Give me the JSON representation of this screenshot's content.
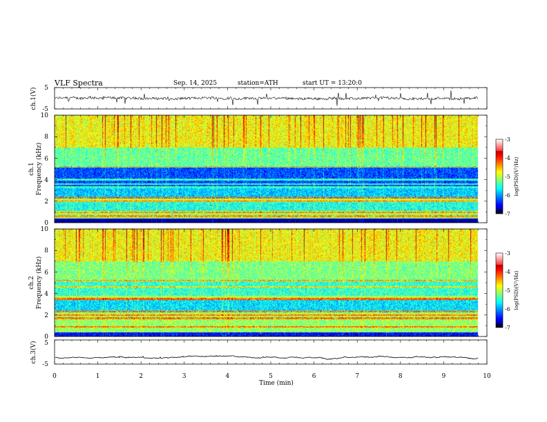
{
  "header": {
    "title": "VLF  Spectra",
    "date": "Sep. 14, 2025",
    "station": "station=ATH",
    "start_ut": "start  UT  =    13:20:0"
  },
  "chart_data": [
    {
      "type": "line",
      "panel": "ch1-waveform",
      "ylabel": "ch.1(V)",
      "ylim": [
        -5,
        5
      ],
      "yticks": [
        "5",
        "-5"
      ],
      "xlim": [
        0,
        10
      ],
      "mean": 0.0,
      "amplitude": 1.2,
      "spike_amplitude": 3.5,
      "end_min": 9.8,
      "color": "#000000"
    },
    {
      "type": "heatmap",
      "panel": "ch1-spectrogram",
      "ylabel_top": "ch.1",
      "ylabel": "Frequency  (kHz)",
      "ylim": [
        0,
        10
      ],
      "yticks": [
        "0",
        "2",
        "4",
        "6",
        "8",
        "10"
      ],
      "xlim": [
        0,
        10
      ],
      "end_min": 9.8,
      "colorbar": {
        "label": "log(PSD)(V²/Hz)",
        "range": [
          -7,
          -3
        ],
        "ticks": [
          "-3",
          "-4",
          "-5",
          "-6",
          "-7"
        ]
      },
      "bands": [
        {
          "f": [
            0.0,
            0.4
          ],
          "psd": -6.9
        },
        {
          "f": [
            0.4,
            1.0
          ],
          "psd": -5.0
        },
        {
          "f": [
            1.0,
            2.0
          ],
          "psd": -5.4
        },
        {
          "f": [
            2.0,
            2.4
          ],
          "psd": -4.8
        },
        {
          "f": [
            2.4,
            3.2
          ],
          "psd": -5.7
        },
        {
          "f": [
            3.2,
            5.2
          ],
          "psd": -6.2
        },
        {
          "f": [
            5.2,
            7.0
          ],
          "psd": -5.1
        },
        {
          "f": [
            7.0,
            10.0
          ],
          "psd": -4.5
        }
      ],
      "lines_khz": [
        0.6,
        1.0,
        2.0,
        2.3,
        3.3,
        3.6,
        4.0,
        5.2
      ]
    },
    {
      "type": "heatmap",
      "panel": "ch2-spectrogram",
      "ylabel_top": "ch.2",
      "ylabel": "Frequency  (kHz)",
      "ylim": [
        0,
        10
      ],
      "yticks": [
        "0",
        "2",
        "4",
        "6",
        "8",
        "10"
      ],
      "xlim": [
        0,
        10
      ],
      "end_min": 9.8,
      "colorbar": {
        "label": "log(PSD)(V²/Hz)",
        "range": [
          -7,
          -3
        ],
        "ticks": [
          "-3",
          "-4",
          "-5",
          "-6",
          "-7"
        ]
      },
      "bands": [
        {
          "f": [
            0.0,
            0.4
          ],
          "psd": -6.5
        },
        {
          "f": [
            0.4,
            2.4
          ],
          "psd": -4.9
        },
        {
          "f": [
            2.4,
            3.4
          ],
          "psd": -5.6
        },
        {
          "f": [
            3.4,
            3.8
          ],
          "psd": -4.8
        },
        {
          "f": [
            3.8,
            5.2
          ],
          "psd": -5.3
        },
        {
          "f": [
            5.2,
            7.0
          ],
          "psd": -5.0
        },
        {
          "f": [
            7.0,
            10.0
          ],
          "psd": -4.5
        }
      ],
      "lines_khz": [
        0.9,
        1.7,
        2.0,
        2.3,
        3.5,
        4.6,
        5.2
      ]
    },
    {
      "type": "line",
      "panel": "ch3-waveform",
      "ylabel": "ch.3(V)",
      "ylim": [
        -5,
        5
      ],
      "yticks": [
        "5",
        "-5"
      ],
      "xlim": [
        0,
        10
      ],
      "xlabel": "Time  (min)",
      "xticks": [
        "0",
        "1",
        "2",
        "3",
        "4",
        "5",
        "6",
        "7",
        "8",
        "9",
        "10"
      ],
      "mean": -2.3,
      "amplitude": 0.25,
      "spike_amplitude": 0.3,
      "end_min": 9.8,
      "color": "#000000"
    }
  ]
}
